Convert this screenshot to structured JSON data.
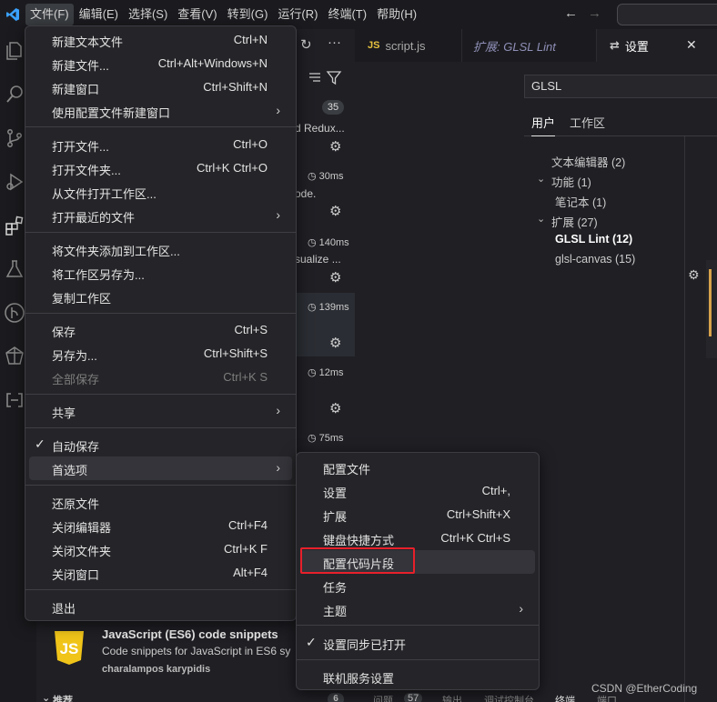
{
  "menubar": {
    "items": [
      "文件(F)",
      "编辑(E)",
      "选择(S)",
      "查看(V)",
      "转到(G)",
      "运行(R)",
      "终端(T)",
      "帮助(H)"
    ]
  },
  "colors": {
    "accent": "#007acc",
    "highlight_box": "#e8202a",
    "scrollbar_accent": "#d7a24a",
    "js_logo": "#f0c419"
  },
  "sidebar": {
    "count_badge": "35",
    "fragments": [
      "d Redux...",
      "ode.",
      "sualize ..."
    ],
    "times": [
      "30ms",
      "140ms",
      "139ms",
      "12ms",
      "75ms"
    ],
    "ext_js": {
      "logo_text": "JS",
      "name": "JavaScript (ES6) code snippets",
      "description": "Code snippets for JavaScript in ES6 sy",
      "author": "charalampos karypidis"
    },
    "recommend_label": "推荐",
    "recommend_count": "6"
  },
  "tabs": {
    "script": {
      "icon": "JS",
      "label": "script.js"
    },
    "ext": {
      "label": "扩展: GLSL Lint"
    },
    "settings": {
      "label": "设置"
    }
  },
  "settings": {
    "search_value": "GLSL",
    "scope_user": "用户",
    "scope_workspace": "工作区",
    "toc": {
      "text_editor": "文本编辑器 (2)",
      "features": "功能 (1)",
      "notebook": "笔记本 (1)",
      "extensions": "扩展 (27)",
      "glsl_lint": "GLSL Lint (12)",
      "glsl_canvas": "glsl-canvas (15)"
    }
  },
  "panel": {
    "problems": "问题",
    "problems_count": "57",
    "output": "输出",
    "debug": "调试控制台",
    "terminal": "终端",
    "ports": "端口"
  },
  "watermark": "CSDN @EtherCoding",
  "file_menu": {
    "new_text_file": {
      "label": "新建文本文件",
      "key": "Ctrl+N"
    },
    "new_file": {
      "label": "新建文件...",
      "key": "Ctrl+Alt+Windows+N"
    },
    "new_window": {
      "label": "新建窗口",
      "key": "Ctrl+Shift+N"
    },
    "new_window_profile": {
      "label": "使用配置文件新建窗口"
    },
    "open_file": {
      "label": "打开文件...",
      "key": "Ctrl+O"
    },
    "open_folder": {
      "label": "打开文件夹...",
      "key": "Ctrl+K Ctrl+O"
    },
    "open_workspace": {
      "label": "从文件打开工作区..."
    },
    "open_recent": {
      "label": "打开最近的文件"
    },
    "add_folder": {
      "label": "将文件夹添加到工作区..."
    },
    "save_workspace_as": {
      "label": "将工作区另存为..."
    },
    "duplicate_workspace": {
      "label": "复制工作区"
    },
    "save": {
      "label": "保存",
      "key": "Ctrl+S"
    },
    "save_as": {
      "label": "另存为...",
      "key": "Ctrl+Shift+S"
    },
    "save_all": {
      "label": "全部保存",
      "key": "Ctrl+K S"
    },
    "share": {
      "label": "共享"
    },
    "auto_save": {
      "label": "自动保存"
    },
    "preferences": {
      "label": "首选项"
    },
    "revert": {
      "label": "还原文件"
    },
    "close_editor": {
      "label": "关闭编辑器",
      "key": "Ctrl+F4"
    },
    "close_folder": {
      "label": "关闭文件夹",
      "key": "Ctrl+K F"
    },
    "close_window": {
      "label": "关闭窗口",
      "key": "Alt+F4"
    },
    "exit": {
      "label": "退出"
    }
  },
  "prefs_menu": {
    "profiles": {
      "label": "配置文件"
    },
    "settings": {
      "label": "设置",
      "key": "Ctrl+,"
    },
    "extensions": {
      "label": "扩展",
      "key": "Ctrl+Shift+X"
    },
    "keybindings": {
      "label": "键盘快捷方式",
      "key": "Ctrl+K Ctrl+S"
    },
    "snippets": {
      "label": "配置代码片段"
    },
    "tasks": {
      "label": "任务"
    },
    "themes": {
      "label": "主题"
    },
    "settings_sync": {
      "label": "设置同步已打开"
    },
    "online_services": {
      "label": "联机服务设置"
    }
  }
}
